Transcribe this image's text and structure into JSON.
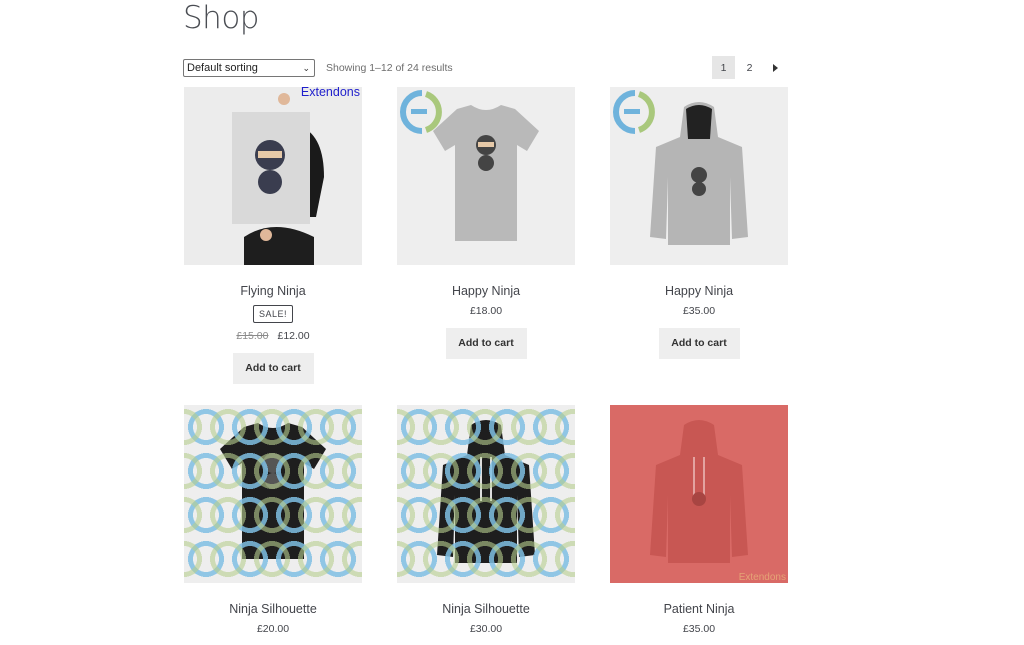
{
  "page": {
    "title": "Shop"
  },
  "toolbar": {
    "sorting": "Default sorting",
    "result_count": "Showing 1–12 of 24 results",
    "pages": [
      "1",
      "2"
    ],
    "current_page": "1"
  },
  "watermark": {
    "text": "Extendons",
    "text_color": "#1f1fcc"
  },
  "products": [
    {
      "title": "Flying Ninja",
      "badge": "SALE!",
      "old_price": "£15.00",
      "price": "£12.00",
      "button": "Add to cart"
    },
    {
      "title": "Happy Ninja",
      "price": "£18.00",
      "button": "Add to cart"
    },
    {
      "title": "Happy Ninja",
      "price": "£35.00",
      "button": "Add to cart"
    },
    {
      "title": "Ninja Silhouette",
      "price": "£20.00"
    },
    {
      "title": "Ninja Silhouette",
      "price": "£30.00"
    },
    {
      "title": "Patient Ninja",
      "price": "£35.00",
      "thumb_overlay": "Extendons"
    }
  ],
  "colors": {
    "thumb_bg": "#eeeeee",
    "red_overlay": "#d96a66",
    "logo_blue": "#6fb3dc",
    "logo_green": "#a9c87c"
  }
}
